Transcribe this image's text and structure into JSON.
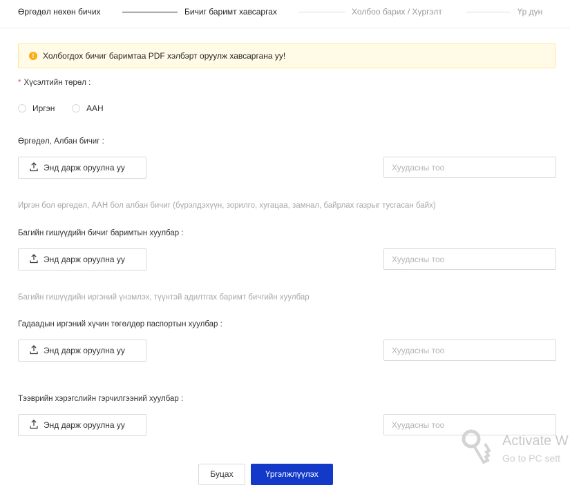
{
  "steps": [
    {
      "label": "Өргөдөл нөхөн бичих",
      "state": "done"
    },
    {
      "label": "Бичиг баримт хавсаргах",
      "state": "current"
    },
    {
      "label": "Холбоо барих / Хүргэлт",
      "state": "pending"
    },
    {
      "label": "Үр дүн",
      "state": "pending"
    }
  ],
  "alert": {
    "icon": "warning-icon",
    "text": "Холбогдох бичиг баримтаа PDF хэлбэрт оруулж хавсаргана уу!",
    "color": "#faad14"
  },
  "request_type": {
    "required_mark": "*",
    "label": "Хүсэлтийн төрөл :",
    "options": [
      {
        "label": "Иргэн",
        "selected": false
      },
      {
        "label": "ААН",
        "selected": false
      }
    ]
  },
  "sections": [
    {
      "label": "Өргөдөл, Албан бичиг :",
      "upload_label": "Энд дарж оруулна уу",
      "pages_placeholder": "Хуудасны тоо",
      "hint": "Иргэн бол өргөдөл, ААН бол албан бичиг (бүрэлдэхүүн, зорилго, хугацаа, замнал, байрлах газрыг тусгасан байх)"
    },
    {
      "label": "Багийн гишүүдийн бичиг баримтын хуулбар :",
      "upload_label": "Энд дарж оруулна уу",
      "pages_placeholder": "Хуудасны тоо",
      "hint": "Багийн гишүүдийн иргэний үнэмлэх, түүнтэй адилтгах баримт бичгийн хуулбар"
    },
    {
      "label": "Гадаадын иргэний хүчин төгөлдөр паспортын хуулбар :",
      "upload_label": "Энд дарж оруулна уу",
      "pages_placeholder": "Хуудасны тоо"
    },
    {
      "label": "Тээврийн хэрэгслийн гэрчилгээний хуулбар :",
      "upload_label": "Энд дарж оруулна уу",
      "pages_placeholder": "Хуудасны тоо"
    }
  ],
  "buttons": {
    "back": "Буцах",
    "next": "Үргэлжлүүлэх",
    "primary_color": "#1339c8"
  },
  "watermark": {
    "title": "Activate W",
    "subtitle": "Go to PC sett"
  }
}
